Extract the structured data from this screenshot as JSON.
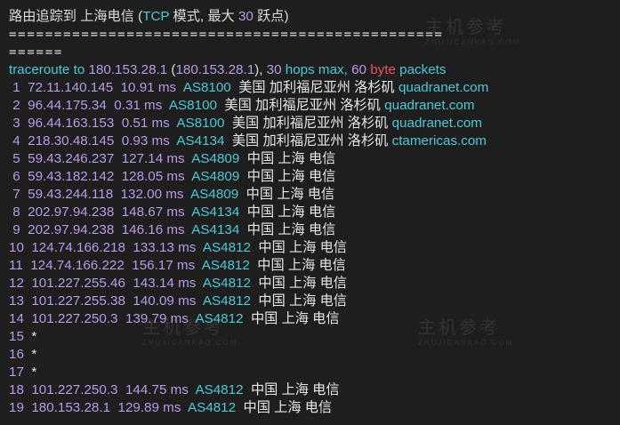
{
  "header": {
    "title_prefix": "路由追踪到 上海电信 (",
    "protocol": "TCP",
    "mode_label": " 模式, 最大 ",
    "max_hops": "30",
    "suffix": " 跃点)"
  },
  "separator": {
    "line1": "================================================",
    "line2": "======"
  },
  "traceroute": {
    "cmd": "traceroute to ",
    "target_ip": "180.153.28.1",
    "paren_open": " (",
    "target_ip_paren": "180.153.28.1",
    "paren_close": "), ",
    "hops": "30",
    "hops_max_label": " hops max, ",
    "byte_count": "60",
    "byte_label": "byte",
    "packets_label": " packets"
  },
  "hops": [
    {
      "n": "1",
      "ip": "72.11.140.145",
      "ms": "10.91 ms",
      "asn": "AS8100",
      "loc": "美国 加利福尼亚州 洛杉矶",
      "host": "quadranet.com"
    },
    {
      "n": "2",
      "ip": "96.44.175.34",
      "ms": "0.31 ms",
      "asn": "AS8100",
      "loc": "美国 加利福尼亚州 洛杉矶",
      "host": "quadranet.com"
    },
    {
      "n": "3",
      "ip": "96.44.163.153",
      "ms": "0.51 ms",
      "asn": "AS8100",
      "loc": "美国 加利福尼亚州 洛杉矶",
      "host": "quadranet.com"
    },
    {
      "n": "4",
      "ip": "218.30.48.145",
      "ms": "0.93 ms",
      "asn": "AS4134",
      "loc": "美国 加利福尼亚州 洛杉矶",
      "host": "ctamericas.com"
    },
    {
      "n": "5",
      "ip": "59.43.246.237",
      "ms": "127.14 ms",
      "asn": "AS4809",
      "loc": "中国 上海 电信",
      "host": ""
    },
    {
      "n": "6",
      "ip": "59.43.182.142",
      "ms": "128.05 ms",
      "asn": "AS4809",
      "loc": "中国 上海 电信",
      "host": ""
    },
    {
      "n": "7",
      "ip": "59.43.244.118",
      "ms": "132.00 ms",
      "asn": "AS4809",
      "loc": "中国 上海 电信",
      "host": ""
    },
    {
      "n": "8",
      "ip": "202.97.94.238",
      "ms": "148.67 ms",
      "asn": "AS4134",
      "loc": "中国 上海 电信",
      "host": ""
    },
    {
      "n": "9",
      "ip": "202.97.94.238",
      "ms": "146.16 ms",
      "asn": "AS4134",
      "loc": "中国 上海 电信",
      "host": ""
    },
    {
      "n": "10",
      "ip": "124.74.166.218",
      "ms": "133.13 ms",
      "asn": "AS4812",
      "loc": "中国 上海 电信",
      "host": ""
    },
    {
      "n": "11",
      "ip": "124.74.166.222",
      "ms": "156.17 ms",
      "asn": "AS4812",
      "loc": "中国 上海 电信",
      "host": ""
    },
    {
      "n": "12",
      "ip": "101.227.255.46",
      "ms": "143.14 ms",
      "asn": "AS4812",
      "loc": "中国 上海 电信",
      "host": ""
    },
    {
      "n": "13",
      "ip": "101.227.255.38",
      "ms": "140.09 ms",
      "asn": "AS4812",
      "loc": "中国 上海 电信",
      "host": ""
    },
    {
      "n": "14",
      "ip": "101.227.250.3",
      "ms": "139.79 ms",
      "asn": "AS4812",
      "loc": "中国 上海 电信",
      "host": ""
    },
    {
      "n": "15",
      "ip": "*",
      "ms": "",
      "asn": "",
      "loc": "",
      "host": ""
    },
    {
      "n": "16",
      "ip": "*",
      "ms": "",
      "asn": "",
      "loc": "",
      "host": ""
    },
    {
      "n": "17",
      "ip": "*",
      "ms": "",
      "asn": "",
      "loc": "",
      "host": ""
    },
    {
      "n": "18",
      "ip": "101.227.250.3",
      "ms": "144.75 ms",
      "asn": "AS4812",
      "loc": "中国 上海 电信",
      "host": ""
    },
    {
      "n": "19",
      "ip": "180.153.28.1",
      "ms": "129.89 ms",
      "asn": "AS4812",
      "loc": "中国 上海 电信",
      "host": ""
    }
  ],
  "watermark": {
    "title": "主机参考",
    "domain": "ZHUJICANKAO.COM"
  },
  "colors": {
    "background": "#1e1e1e",
    "text": "#dcdcdc",
    "cyan": "#4ec9d6",
    "violet": "#b99ae8",
    "red": "#f0505c"
  }
}
